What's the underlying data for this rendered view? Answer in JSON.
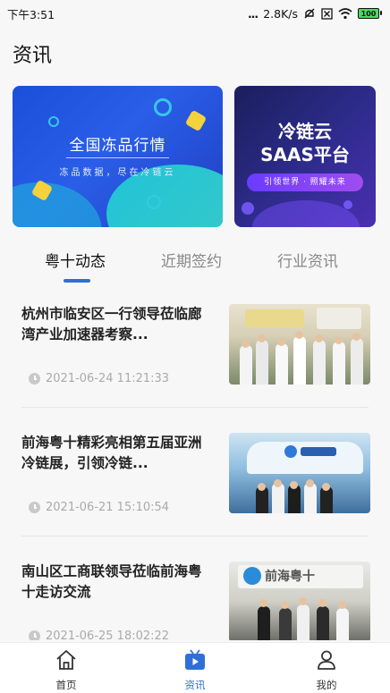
{
  "status_bar": {
    "time": "下午3:51",
    "signal_text": "...",
    "network_speed": "2.8K/s",
    "battery": "100",
    "icons": [
      "mute-icon",
      "sim-icon",
      "wifi-icon",
      "battery-icon"
    ]
  },
  "header": {
    "title": "资讯"
  },
  "banners": [
    {
      "title": "全国冻品行情",
      "subtitle": "冻品数据，尽在冷链云"
    },
    {
      "title_line1": "冷链云",
      "title_line2": "SAAS平台",
      "tagline": "引领世界 · 照耀未来"
    }
  ],
  "tabs": [
    {
      "label": "粤十动态",
      "active": true
    },
    {
      "label": "近期签约",
      "active": false
    },
    {
      "label": "行业资讯",
      "active": false
    }
  ],
  "news": [
    {
      "title": "杭州市临安区一行领导莅临廊湾产业加速器考察...",
      "time": "2021-06-24 11:21:33"
    },
    {
      "title": "前海粤十精彩亮相第五届亚洲冷链展，引领冷链...",
      "time": "2021-06-21 15:10:54"
    },
    {
      "title": "南山区工商联领导莅临前海粤十走访交流",
      "time": "2021-06-25 18:02:22",
      "image_sign": "前海粤十"
    }
  ],
  "bottom_nav": [
    {
      "label": "首页",
      "icon": "home-icon",
      "active": false
    },
    {
      "label": "资讯",
      "icon": "tv-icon",
      "active": true
    },
    {
      "label": "我的",
      "icon": "user-icon",
      "active": false
    }
  ],
  "colors": {
    "accent": "#2f6fd8",
    "page_bg": "#f7f7f7"
  }
}
